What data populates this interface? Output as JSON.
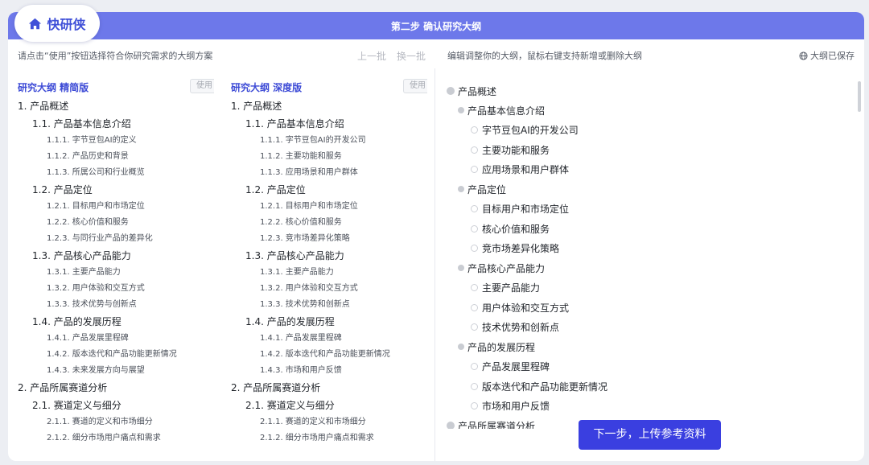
{
  "logo": {
    "text": "快研侠"
  },
  "header": {
    "title": "第二步 确认研究大纲"
  },
  "left_panel": {
    "hint": "请点击“使用”按钮选择符合你研究需求的大纲方案",
    "prev_batch": "上一批",
    "next_batch": "换一批",
    "outlines": [
      {
        "title": "研究大纲 精简版",
        "use_label": "使用",
        "items": [
          {
            "level": 1,
            "text": "1. 产品概述"
          },
          {
            "level": 2,
            "text": "1.1. 产品基本信息介绍"
          },
          {
            "level": 3,
            "text": "1.1.1. 字节豆包AI的定义"
          },
          {
            "level": 3,
            "text": "1.1.2. 产品历史和背景"
          },
          {
            "level": 3,
            "text": "1.1.3. 所属公司和行业概览"
          },
          {
            "level": 2,
            "text": "1.2. 产品定位"
          },
          {
            "level": 3,
            "text": "1.2.1. 目标用户和市场定位"
          },
          {
            "level": 3,
            "text": "1.2.2. 核心价值和服务"
          },
          {
            "level": 3,
            "text": "1.2.3. 与同行业产品的差异化"
          },
          {
            "level": 2,
            "text": "1.3. 产品核心产品能力"
          },
          {
            "level": 3,
            "text": "1.3.1. 主要产品能力"
          },
          {
            "level": 3,
            "text": "1.3.2. 用户体验和交互方式"
          },
          {
            "level": 3,
            "text": "1.3.3. 技术优势与创新点"
          },
          {
            "level": 2,
            "text": "1.4. 产品的发展历程"
          },
          {
            "level": 3,
            "text": "1.4.1. 产品发展里程碑"
          },
          {
            "level": 3,
            "text": "1.4.2. 版本迭代和产品功能更新情况"
          },
          {
            "level": 3,
            "text": "1.4.3. 未来发展方向与展望"
          },
          {
            "level": 1,
            "text": "2. 产品所属赛道分析"
          },
          {
            "level": 2,
            "text": "2.1. 赛道定义与细分"
          },
          {
            "level": 3,
            "text": "2.1.1. 赛道的定义和市场细分"
          },
          {
            "level": 3,
            "text": "2.1.2. 细分市场用户痛点和需求"
          }
        ]
      },
      {
        "title": "研究大纲 深度版",
        "use_label": "使用",
        "items": [
          {
            "level": 1,
            "text": "1. 产品概述"
          },
          {
            "level": 2,
            "text": "1.1. 产品基本信息介绍"
          },
          {
            "level": 3,
            "text": "1.1.1. 字节豆包AI的开发公司"
          },
          {
            "level": 3,
            "text": "1.1.2. 主要功能和服务"
          },
          {
            "level": 3,
            "text": "1.1.3. 应用场景和用户群体"
          },
          {
            "level": 2,
            "text": "1.2. 产品定位"
          },
          {
            "level": 3,
            "text": "1.2.1. 目标用户和市场定位"
          },
          {
            "level": 3,
            "text": "1.2.2. 核心价值和服务"
          },
          {
            "level": 3,
            "text": "1.2.3. 竞市场差异化策略"
          },
          {
            "level": 2,
            "text": "1.3. 产品核心产品能力"
          },
          {
            "level": 3,
            "text": "1.3.1. 主要产品能力"
          },
          {
            "level": 3,
            "text": "1.3.2. 用户体验和交互方式"
          },
          {
            "level": 3,
            "text": "1.3.3. 技术优势和创新点"
          },
          {
            "level": 2,
            "text": "1.4. 产品的发展历程"
          },
          {
            "level": 3,
            "text": "1.4.1. 产品发展里程碑"
          },
          {
            "level": 3,
            "text": "1.4.2. 版本迭代和产品功能更新情况"
          },
          {
            "level": 3,
            "text": "1.4.3. 市场和用户反馈"
          },
          {
            "level": 1,
            "text": "2. 产品所属赛道分析"
          },
          {
            "level": 2,
            "text": "2.1. 赛道定义与细分"
          },
          {
            "level": 3,
            "text": "2.1.1. 赛道的定义和市场细分"
          },
          {
            "level": 3,
            "text": "2.1.2. 细分市场用户痛点和需求"
          }
        ]
      }
    ]
  },
  "right_panel": {
    "hint": "编辑调整你的大纲，鼠标右键支持新增或删除大纲",
    "saved_status": "大纲已保存",
    "tree": [
      {
        "level": 1,
        "text": "产品概述"
      },
      {
        "level": 2,
        "text": "产品基本信息介绍"
      },
      {
        "level": 3,
        "text": "字节豆包AI的开发公司"
      },
      {
        "level": 3,
        "text": "主要功能和服务"
      },
      {
        "level": 3,
        "text": "应用场景和用户群体"
      },
      {
        "level": 2,
        "text": "产品定位"
      },
      {
        "level": 3,
        "text": "目标用户和市场定位"
      },
      {
        "level": 3,
        "text": "核心价值和服务"
      },
      {
        "level": 3,
        "text": "竞市场差异化策略"
      },
      {
        "level": 2,
        "text": "产品核心产品能力"
      },
      {
        "level": 3,
        "text": "主要产品能力"
      },
      {
        "level": 3,
        "text": "用户体验和交互方式"
      },
      {
        "level": 3,
        "text": "技术优势和创新点"
      },
      {
        "level": 2,
        "text": "产品的发展历程"
      },
      {
        "level": 3,
        "text": "产品发展里程碑"
      },
      {
        "level": 3,
        "text": "版本迭代和产品功能更新情况"
      },
      {
        "level": 3,
        "text": "市场和用户反馈"
      },
      {
        "level": 1,
        "text": "产品所属赛道分析"
      }
    ],
    "next_button": "下一步，上传参考资料"
  },
  "icons": {
    "logo_icon": "home-icon",
    "saved_icon": "globe-icon"
  },
  "colors": {
    "header": "#6d78ea",
    "accent": "#3d4bd6",
    "primary_button": "#3a3fe0"
  }
}
